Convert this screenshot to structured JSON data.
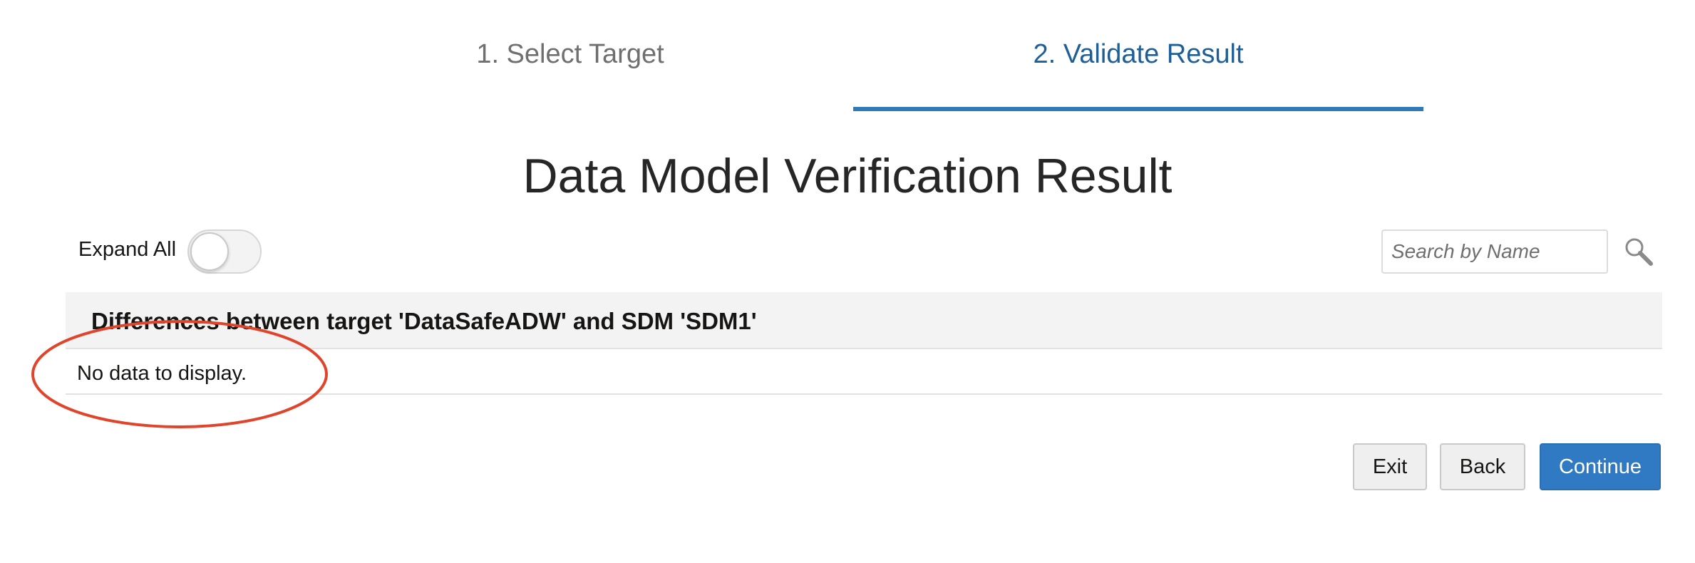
{
  "train": {
    "steps": [
      {
        "label": "1. Select Target",
        "state": "visited"
      },
      {
        "label": "2. Validate Result",
        "state": "current"
      }
    ]
  },
  "page_title": "Data Model Verification Result",
  "toolbar": {
    "expand_all_label": "Expand All",
    "expand_all_on": false,
    "search_placeholder": "Search by Name",
    "search_value": "",
    "search_icon": "magnifier-icon"
  },
  "section": {
    "title": "Differences between target 'DataSafeADW' and SDM 'SDM1'",
    "empty_text": "No data to display."
  },
  "buttons": {
    "exit": "Exit",
    "back": "Back",
    "continue": "Continue"
  },
  "colors": {
    "accent": "#2f7ab7",
    "current_step_text": "#1f5f98",
    "primary_button": "#2f7ac2",
    "annotation": "#e0442b"
  }
}
